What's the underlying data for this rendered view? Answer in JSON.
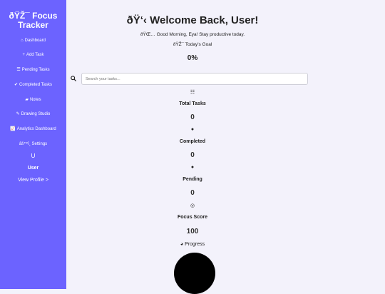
{
  "sidebar": {
    "brand": "ðŸŽ¯ Focus Tracker",
    "items": [
      {
        "icon": "⌂",
        "label": "Dashboard"
      },
      {
        "icon": "+",
        "label": "Add Task"
      },
      {
        "icon": "☰",
        "label": "Pending Tasks"
      },
      {
        "icon": "✔",
        "label": "Completed Tasks"
      },
      {
        "icon": "▰",
        "label": "Notes"
      },
      {
        "icon": "✎",
        "label": "Drawing Studio"
      },
      {
        "icon": "📈",
        "label": "Analytics Dashboard"
      },
      {
        "icon": "",
        "label": "âš™ï¸ Settings"
      }
    ],
    "user_icon": "U",
    "user_name": "User",
    "view_profile": "View Profile >"
  },
  "main": {
    "welcome": "ðŸ‘‹ Welcome Back, User!",
    "greeting": "ðŸŒ… Good Morning, Eya! Stay productive today.",
    "goal_label": "ðŸŽ¯ Today's Goal",
    "goal_value": "0%",
    "search_placeholder": "Search your tasks...",
    "stats": [
      {
        "icon": "☷",
        "label": "Total Tasks",
        "value": "0"
      },
      {
        "icon": "●",
        "label": "Completed",
        "value": "0"
      },
      {
        "icon": "●",
        "label": "Pending",
        "value": "0"
      },
      {
        "icon": "◎",
        "label": "Focus Score",
        "value": "100"
      }
    ],
    "progress_icon": "◕",
    "progress_label": "Progress"
  }
}
